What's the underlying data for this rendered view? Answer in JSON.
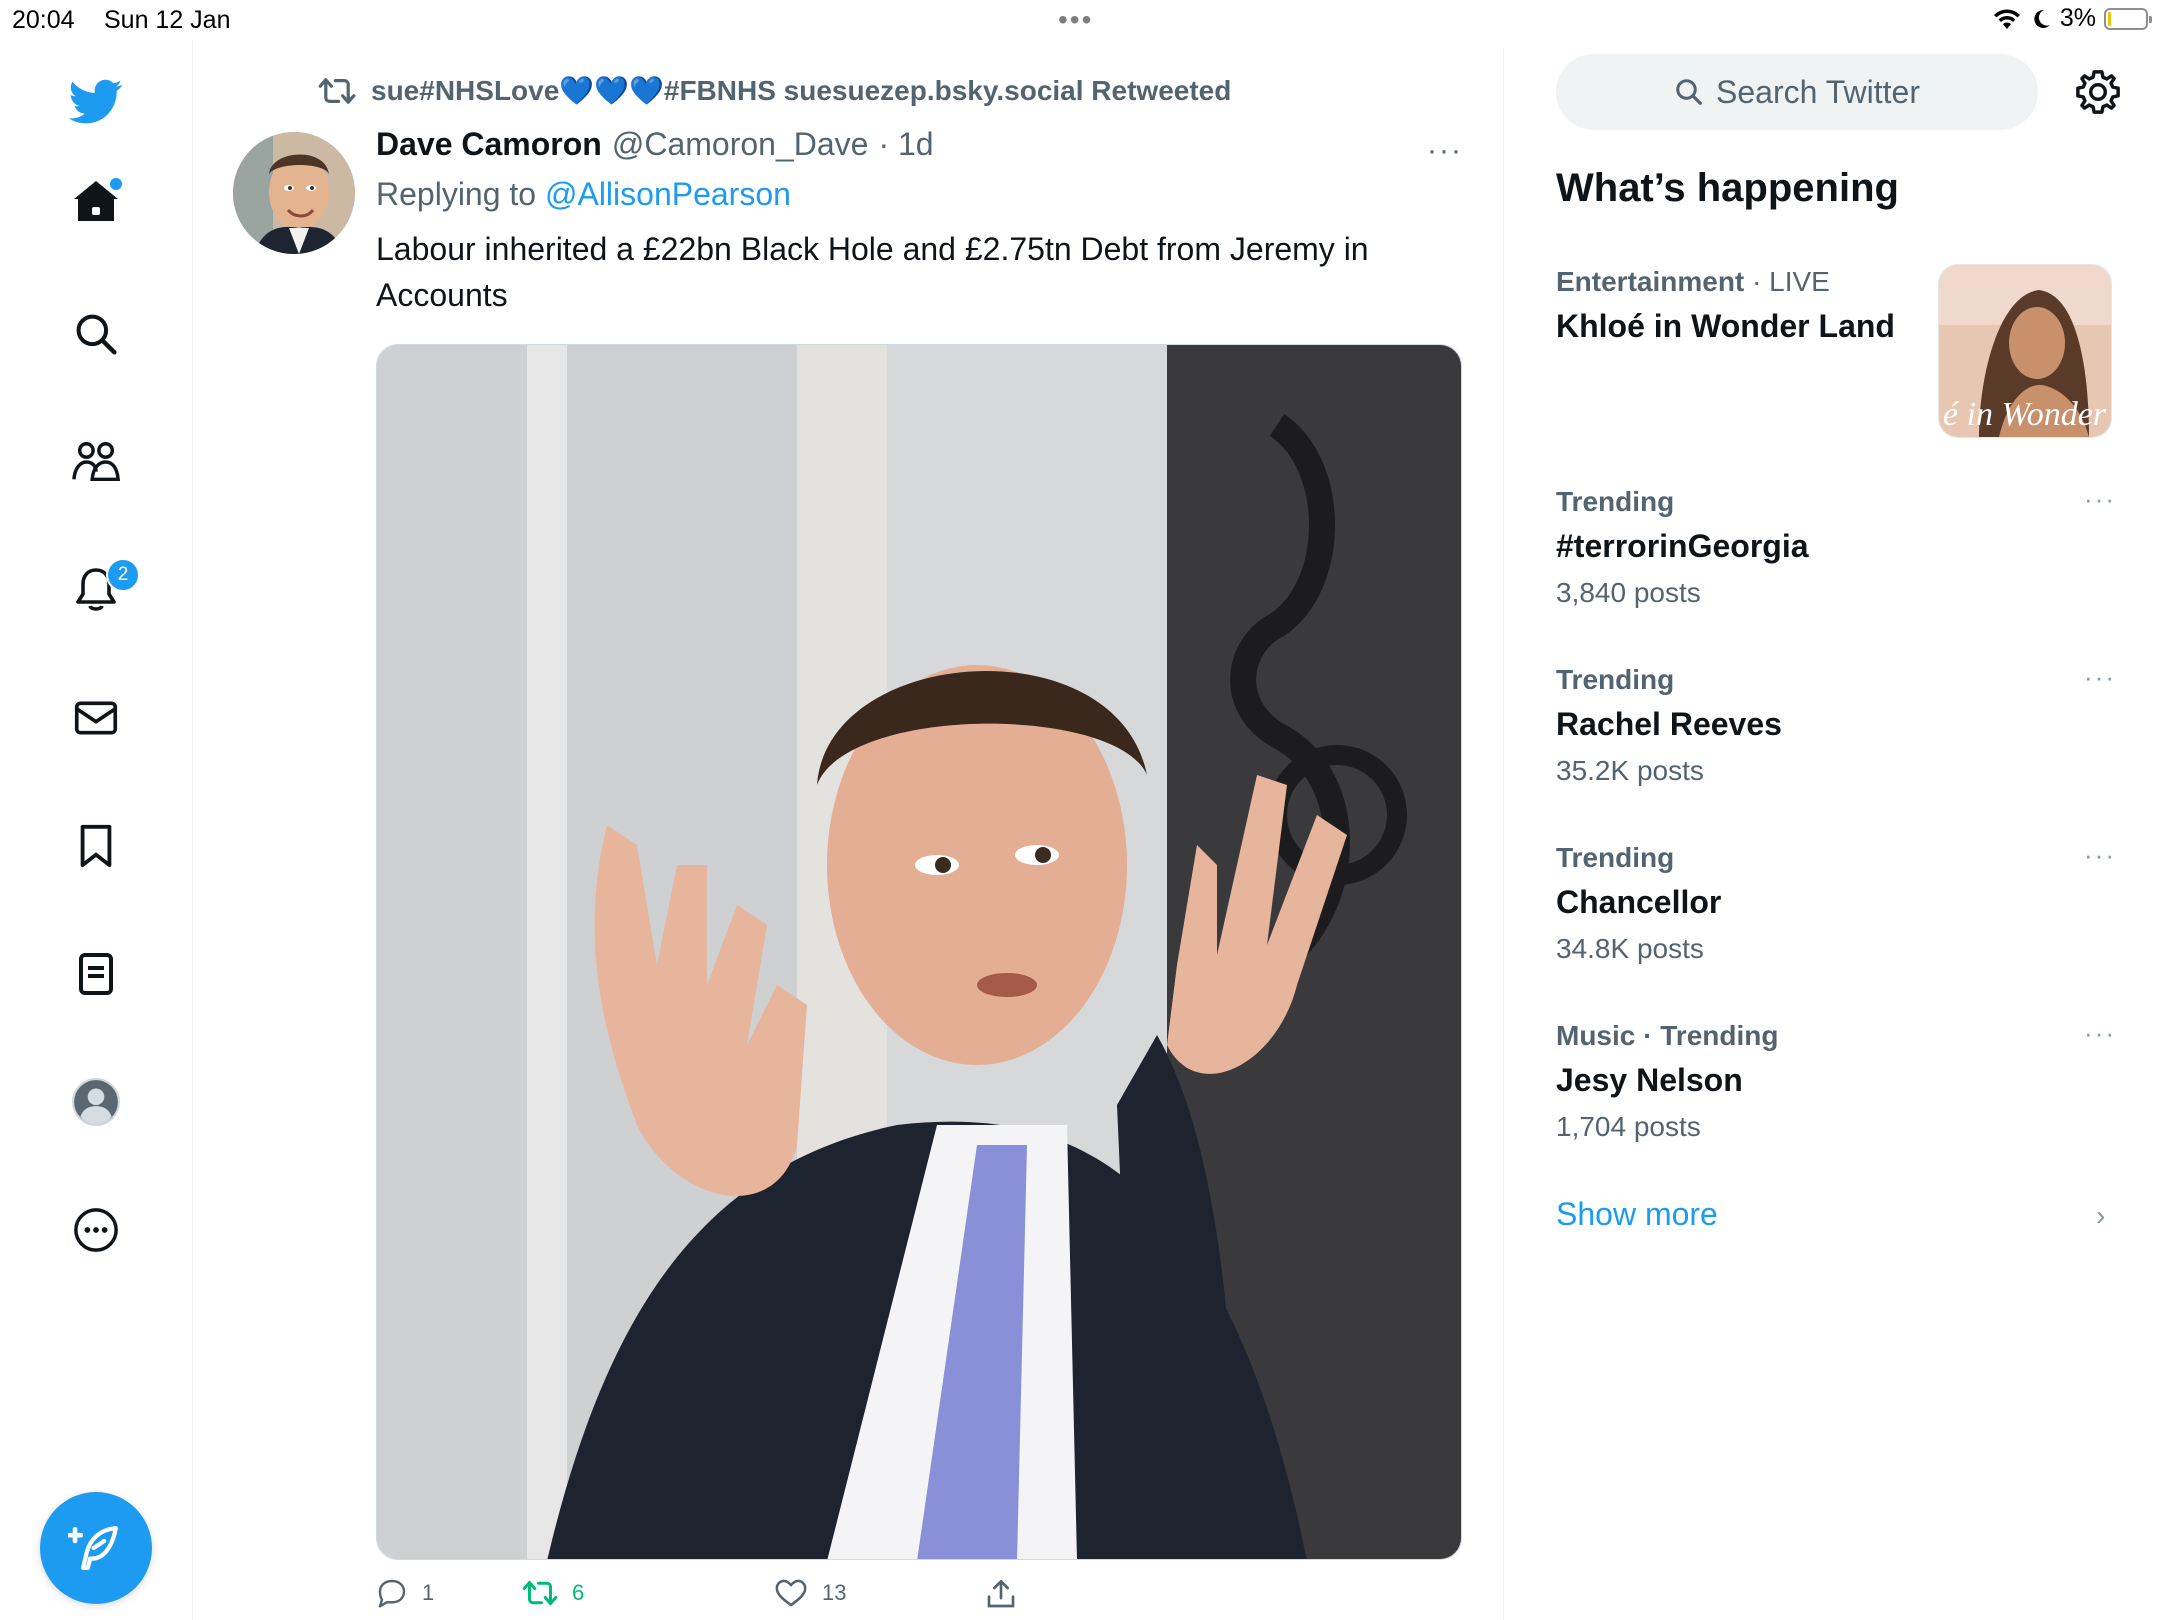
{
  "status_bar": {
    "time": "20:04",
    "date": "Sun 12 Jan",
    "battery": "3%",
    "multitask_dots": "•••"
  },
  "nav": {
    "notifications_badge": "2"
  },
  "tweet": {
    "retweeted_by": "sue#NHSLove💙💙💙#FBNHS suesuezep.bsky.social Retweeted",
    "author_name": "Dave Camoron",
    "author_handle": "@Camoron_Dave",
    "time": "· 1d",
    "more": "···",
    "replying_prefix": "Replying to",
    "replying_to": "@AllisonPearson",
    "text": "Labour inherited a £22bn Black Hole and £2.75tn Debt from Jeremy in Accounts",
    "reply_count": "1",
    "retweet_count": "6",
    "like_count": "13"
  },
  "sidebar": {
    "search_placeholder": "Search Twitter",
    "heading": "What’s happening",
    "trends": [
      {
        "category": "Entertainment",
        "sep": " · ",
        "extra": "LIVE",
        "title": "Khloé in Wonder Land",
        "count": "",
        "image_caption": "é in Wonder L"
      },
      {
        "category": "Trending",
        "title": "#terrorinGeorgia",
        "count": "3,840 posts"
      },
      {
        "category": "Trending",
        "title": "Rachel Reeves",
        "count": "35.2K posts"
      },
      {
        "category": "Trending",
        "title": "Chancellor",
        "count": "34.8K posts"
      },
      {
        "category": "Music · Trending",
        "title": "Jesy Nelson",
        "count": "1,704 posts"
      }
    ],
    "show_more": "Show more"
  },
  "colors": {
    "accent": "#1d9bf0",
    "secondary_text": "#536471",
    "retweet_green": "#00ba7c"
  }
}
